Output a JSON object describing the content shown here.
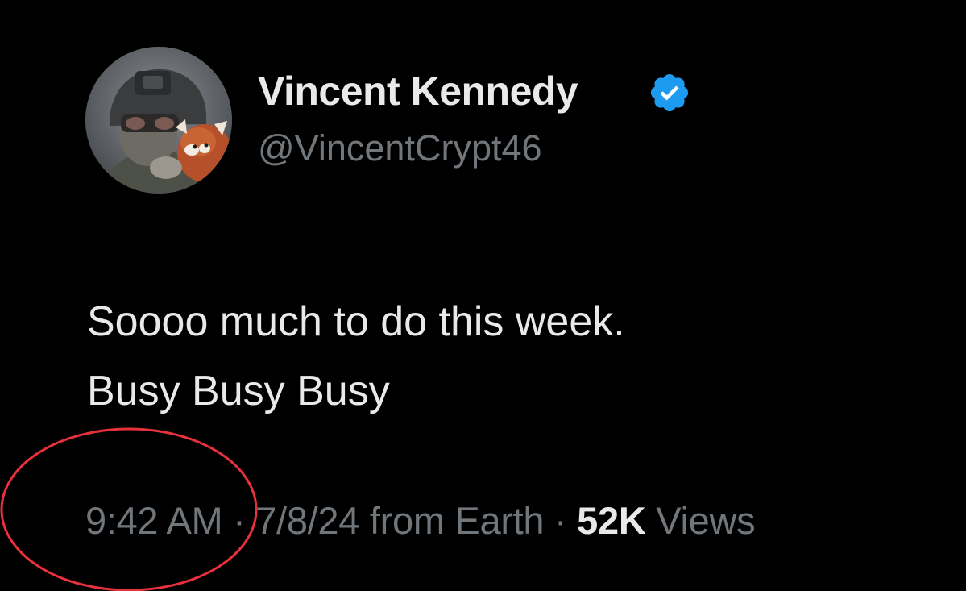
{
  "theme": {
    "background": "#000000",
    "primary_text": "#e7e9ea",
    "secondary_text": "#71767b",
    "verified_color": "#1d9bf0",
    "annotation_color": "#e8313c"
  },
  "author": {
    "display_name": "Vincent Kennedy",
    "handle": "@VincentCrypt46",
    "verified": true,
    "avatar_icon": "profile-photo-soldier-with-red-panda"
  },
  "tweet": {
    "lines": [
      "Soooo much to do this week.",
      "Busy Busy Busy"
    ]
  },
  "meta": {
    "time": "9:42 AM",
    "separator": "·",
    "date": "7/8/24",
    "source": "from Earth",
    "views_count": "52K",
    "views_label": "Views"
  },
  "annotation": {
    "shape": "ellipse",
    "target": "time"
  }
}
